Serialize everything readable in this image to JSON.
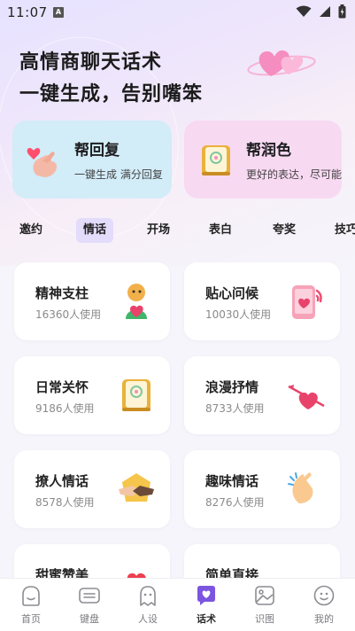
{
  "status_bar": {
    "time": "11:07",
    "notif_badge": "A"
  },
  "header": {
    "line1": "高情商聊天话术",
    "line2": "一键生成，告别嘴笨"
  },
  "features": [
    {
      "title": "帮回复",
      "subtitle": "一键生成 满分回复",
      "icon": "finger-heart-icon"
    },
    {
      "title": "帮润色",
      "subtitle": "更好的表达，尽可能",
      "icon": "notebook-icon"
    }
  ],
  "tabs": [
    "邀约",
    "情话",
    "开场",
    "表白",
    "夸奖",
    "技巧"
  ],
  "active_tab": "情话",
  "topics": [
    {
      "title": "精神支柱",
      "count": "16360人使用",
      "icon": "figure-heart-icon"
    },
    {
      "title": "贴心问候",
      "count": "10030人使用",
      "icon": "phone-heart-icon"
    },
    {
      "title": "日常关怀",
      "count": "9186人使用",
      "icon": "notebook-icon"
    },
    {
      "title": "浪漫抒情",
      "count": "8733人使用",
      "icon": "arrow-heart-icon"
    },
    {
      "title": "撩人情话",
      "count": "8578人使用",
      "icon": "handshake-icon"
    },
    {
      "title": "趣味情话",
      "count": "8276人使用",
      "icon": "clapping-hands-icon"
    },
    {
      "title": "甜蜜赞美",
      "count": "",
      "icon": "hands-heart-icon"
    },
    {
      "title": "简单直接",
      "count": "",
      "icon": "lips-icon"
    }
  ],
  "nav": [
    {
      "label": "首页",
      "icon": "home-face-icon"
    },
    {
      "label": "键盘",
      "icon": "keyboard-icon"
    },
    {
      "label": "人设",
      "icon": "ghost-icon"
    },
    {
      "label": "话术",
      "icon": "chat-heart-icon"
    },
    {
      "label": "识图",
      "icon": "image-icon"
    },
    {
      "label": "我的",
      "icon": "smiley-icon"
    }
  ],
  "active_nav": "话术",
  "colors": {
    "accent": "#7b55e0",
    "reply_card": "#d2ecf8",
    "polish_card": "#f8d9f2",
    "tab_active": "#e3dcfb"
  }
}
